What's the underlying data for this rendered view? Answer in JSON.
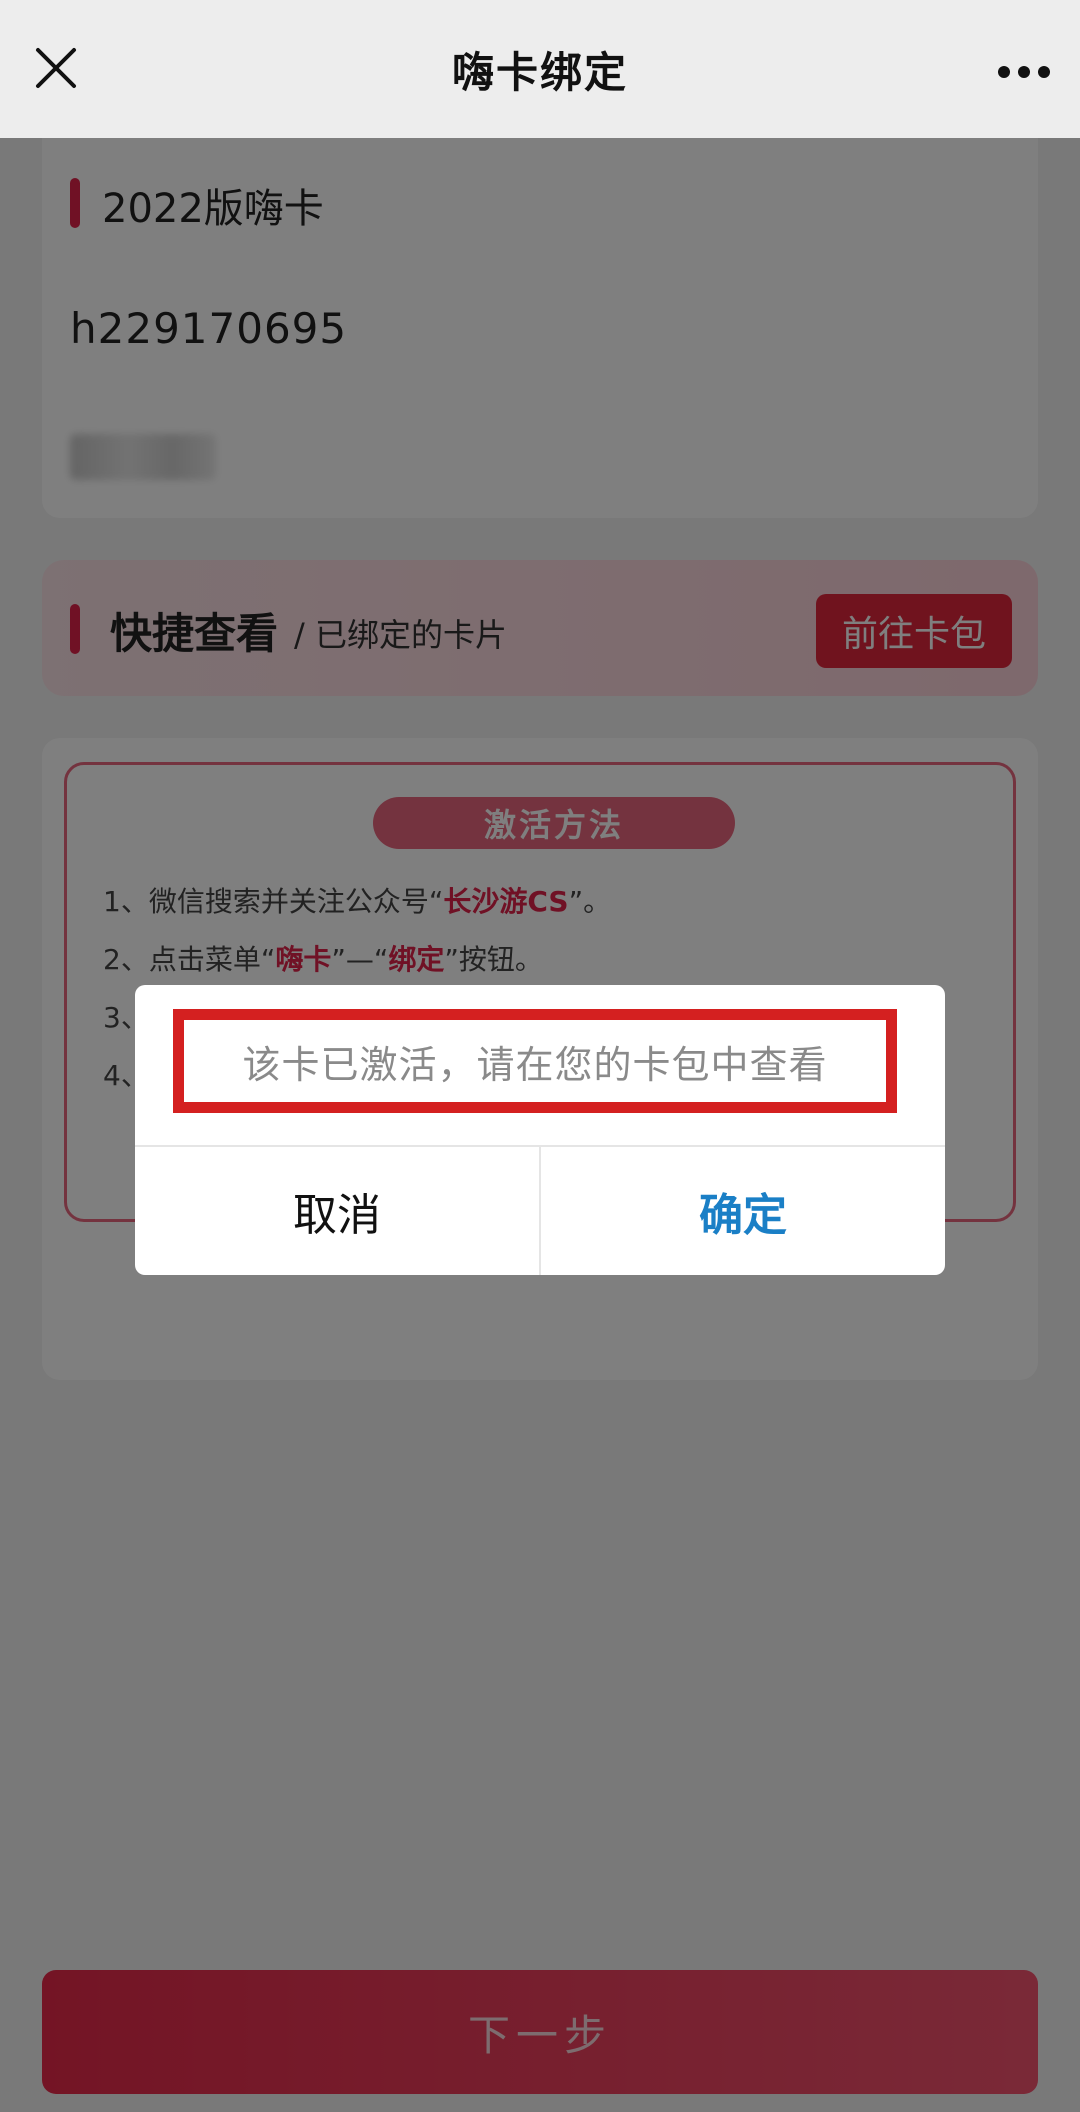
{
  "topbar": {
    "title": "嗨卡绑定",
    "close_icon": "close-icon",
    "more_icon": "more-dots-icon"
  },
  "card_info": {
    "card_name": "2022版嗨卡",
    "card_number": "h229170695",
    "masked_value_icon": "blurred-redacted-text"
  },
  "quick_view": {
    "title": "快捷查看",
    "subtitle": "/ 已绑定的卡片",
    "button": "前往卡包"
  },
  "activation": {
    "heading": "激活方法",
    "step1": {
      "prefix": "1、微信搜索并关注公众号“",
      "highlight": "长沙游CS",
      "suffix": "”。"
    },
    "step2": {
      "prefix": "2、点击菜单“",
      "highlight1": "嗨卡",
      "middle": "”—“",
      "highlight2": "绑定",
      "suffix": "”按钮。"
    },
    "step3": {
      "prefix": "3、"
    },
    "step4": {
      "prefix": "4、"
    }
  },
  "next_button": "下一步",
  "dialog": {
    "message": "该卡已激活，请在您的卡包中查看",
    "cancel": "取消",
    "confirm": "确定"
  },
  "colors": {
    "accent_red": "#e0234a",
    "confirm_blue": "#1a7fc6",
    "highlight_box_red": "#d42020"
  }
}
